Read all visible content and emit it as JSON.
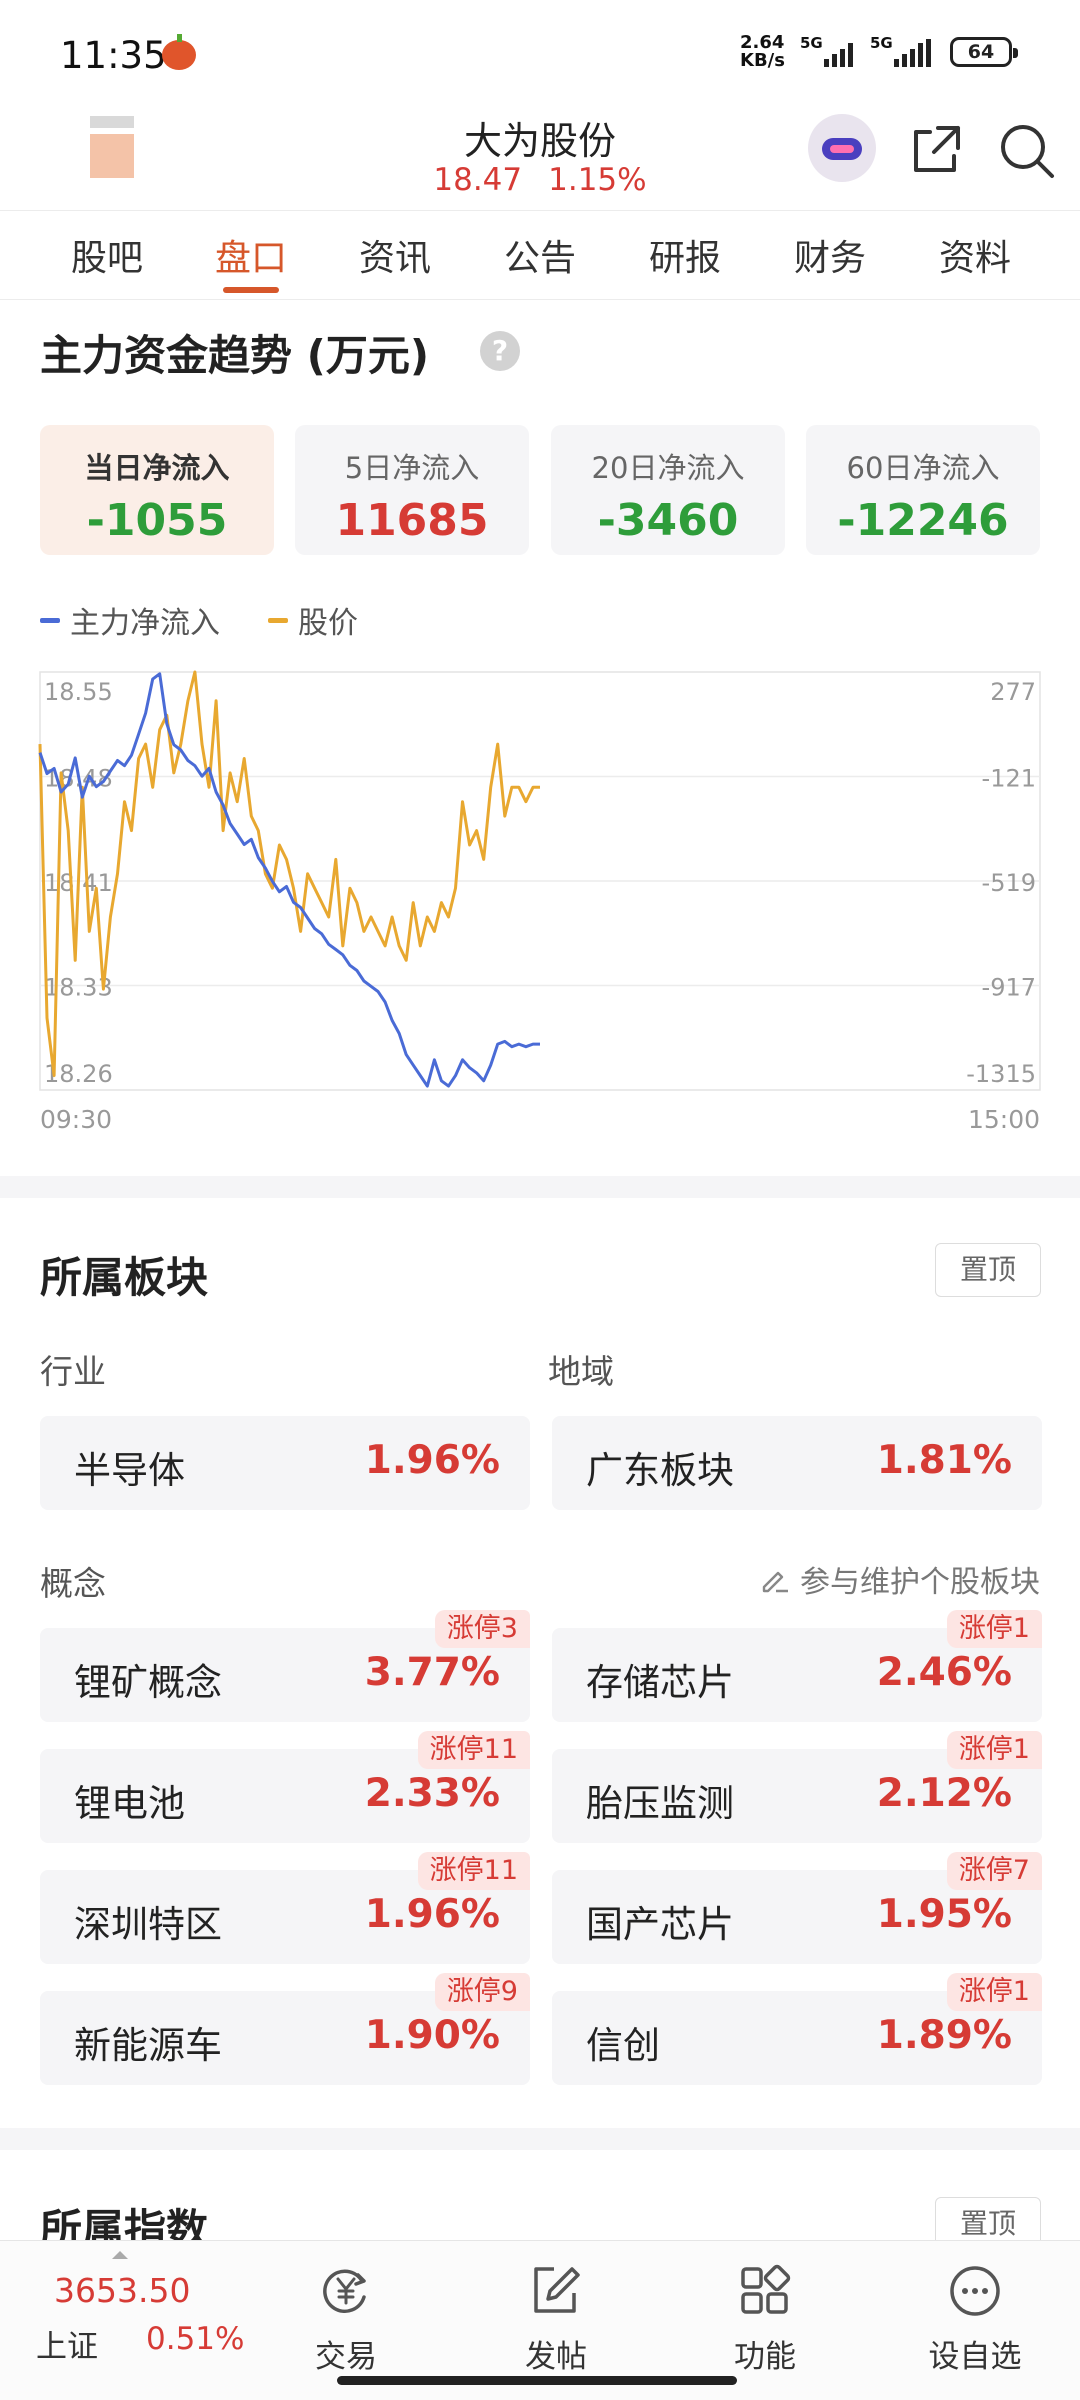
{
  "status_bar": {
    "time": "11:35",
    "net_speed_value": "2.64",
    "net_speed_unit": "KB/s",
    "signal1_label": "5G",
    "signal2_label": "5G",
    "battery": "64"
  },
  "header": {
    "stock_name": "大为股份",
    "price": "18.47",
    "change_pct": "1.15%"
  },
  "tabs": [
    "股吧",
    "盘口",
    "资讯",
    "公告",
    "研报",
    "财务",
    "资料"
  ],
  "active_tab": "盘口",
  "capital": {
    "title": "主力资金趋势 (万元)",
    "help_icon": "?",
    "cards": [
      {
        "label": "当日净流入",
        "value": "-1055"
      },
      {
        "label": "5日净流入",
        "value": "11685"
      },
      {
        "label": "20日净流入",
        "value": "-3460"
      },
      {
        "label": "60日净流入",
        "value": "-12246"
      }
    ],
    "legend": {
      "flow": "主力净流入",
      "price": "股价"
    },
    "colors": {
      "flow": "#4a6bd6",
      "price": "#e8a830",
      "green": "#2e9d3a",
      "red": "#d63b35",
      "accent": "#d6572a"
    }
  },
  "chart_data": {
    "type": "line",
    "x_start_label": "09:30",
    "x_end_label": "15:00",
    "left_axis_ticks": [
      "18.55",
      "18.48",
      "18.41",
      "18.33",
      "18.26"
    ],
    "right_axis_ticks": [
      "277",
      "-121",
      "-519",
      "-917",
      "-1315"
    ],
    "price_range": [
      18.26,
      18.55
    ],
    "flow_range": [
      -1315,
      277
    ],
    "series": [
      {
        "name": "股价",
        "axis": "left",
        "values": [
          18.5,
          18.31,
          18.27,
          18.48,
          18.44,
          18.35,
          18.47,
          18.37,
          18.4,
          18.33,
          18.38,
          18.41,
          18.46,
          18.44,
          18.49,
          18.5,
          18.47,
          18.51,
          18.52,
          18.48,
          18.5,
          18.53,
          18.55,
          18.5,
          18.47,
          18.53,
          18.44,
          18.48,
          18.46,
          18.49,
          18.45,
          18.44,
          18.41,
          18.4,
          18.43,
          18.42,
          18.4,
          18.37,
          18.41,
          18.4,
          18.39,
          18.38,
          18.42,
          18.36,
          18.4,
          18.39,
          18.37,
          18.38,
          18.37,
          18.36,
          18.38,
          18.36,
          18.35,
          18.39,
          18.36,
          18.38,
          18.37,
          18.39,
          18.38,
          18.4,
          18.46,
          18.43,
          18.44,
          18.42,
          18.47,
          18.5,
          18.45,
          18.47,
          18.47,
          18.46,
          18.47,
          18.47
        ]
      },
      {
        "name": "主力净流入",
        "axis": "right",
        "values": [
          -30,
          -110,
          -90,
          -180,
          -150,
          -50,
          -200,
          -120,
          -160,
          -140,
          -100,
          -60,
          -80,
          -40,
          40,
          120,
          250,
          270,
          80,
          0,
          -20,
          -60,
          -80,
          -120,
          -90,
          -180,
          -230,
          -300,
          -340,
          -380,
          -360,
          -430,
          -470,
          -520,
          -560,
          -540,
          -600,
          -620,
          -660,
          -700,
          -720,
          -760,
          -780,
          -800,
          -840,
          -860,
          -900,
          -920,
          -940,
          -980,
          -1050,
          -1100,
          -1180,
          -1220,
          -1260,
          -1300,
          -1200,
          -1280,
          -1300,
          -1260,
          -1200,
          -1230,
          -1250,
          -1280,
          -1220,
          -1140,
          -1130,
          -1150,
          -1140,
          -1150,
          -1140,
          -1140
        ]
      }
    ]
  },
  "sectors": {
    "title": "所属板块",
    "pin_label": "置顶",
    "industry_label": "行业",
    "region_label": "地域",
    "industry": {
      "name": "半导体",
      "pct": "1.96%"
    },
    "region": {
      "name": "广东板块",
      "pct": "1.81%"
    },
    "concept_label": "概念",
    "maintain_link": "参与维护个股板块",
    "concepts": [
      {
        "name": "锂矿概念",
        "pct": "3.77%",
        "badge": "涨停3"
      },
      {
        "name": "存储芯片",
        "pct": "2.46%",
        "badge": "涨停1"
      },
      {
        "name": "锂电池",
        "pct": "2.33%",
        "badge": "涨停11"
      },
      {
        "name": "胎压监测",
        "pct": "2.12%",
        "badge": "涨停1"
      },
      {
        "name": "深圳特区",
        "pct": "1.96%",
        "badge": "涨停11"
      },
      {
        "name": "国产芯片",
        "pct": "1.95%",
        "badge": "涨停7"
      },
      {
        "name": "新能源车",
        "pct": "1.90%",
        "badge": "涨停9"
      },
      {
        "name": "信创",
        "pct": "1.89%",
        "badge": "涨停1"
      }
    ]
  },
  "indices": {
    "title": "所属指数",
    "pin_label": "置顶"
  },
  "bottom_bar": {
    "index_value": "3653.50",
    "index_name": "上证",
    "index_pct": "0.51%",
    "items": [
      {
        "label": "交易",
        "icon": "trade-yen-icon"
      },
      {
        "label": "发帖",
        "icon": "post-edit-icon"
      },
      {
        "label": "功能",
        "icon": "grid-apps-icon"
      },
      {
        "label": "设自选",
        "icon": "more-dots-icon"
      }
    ]
  }
}
